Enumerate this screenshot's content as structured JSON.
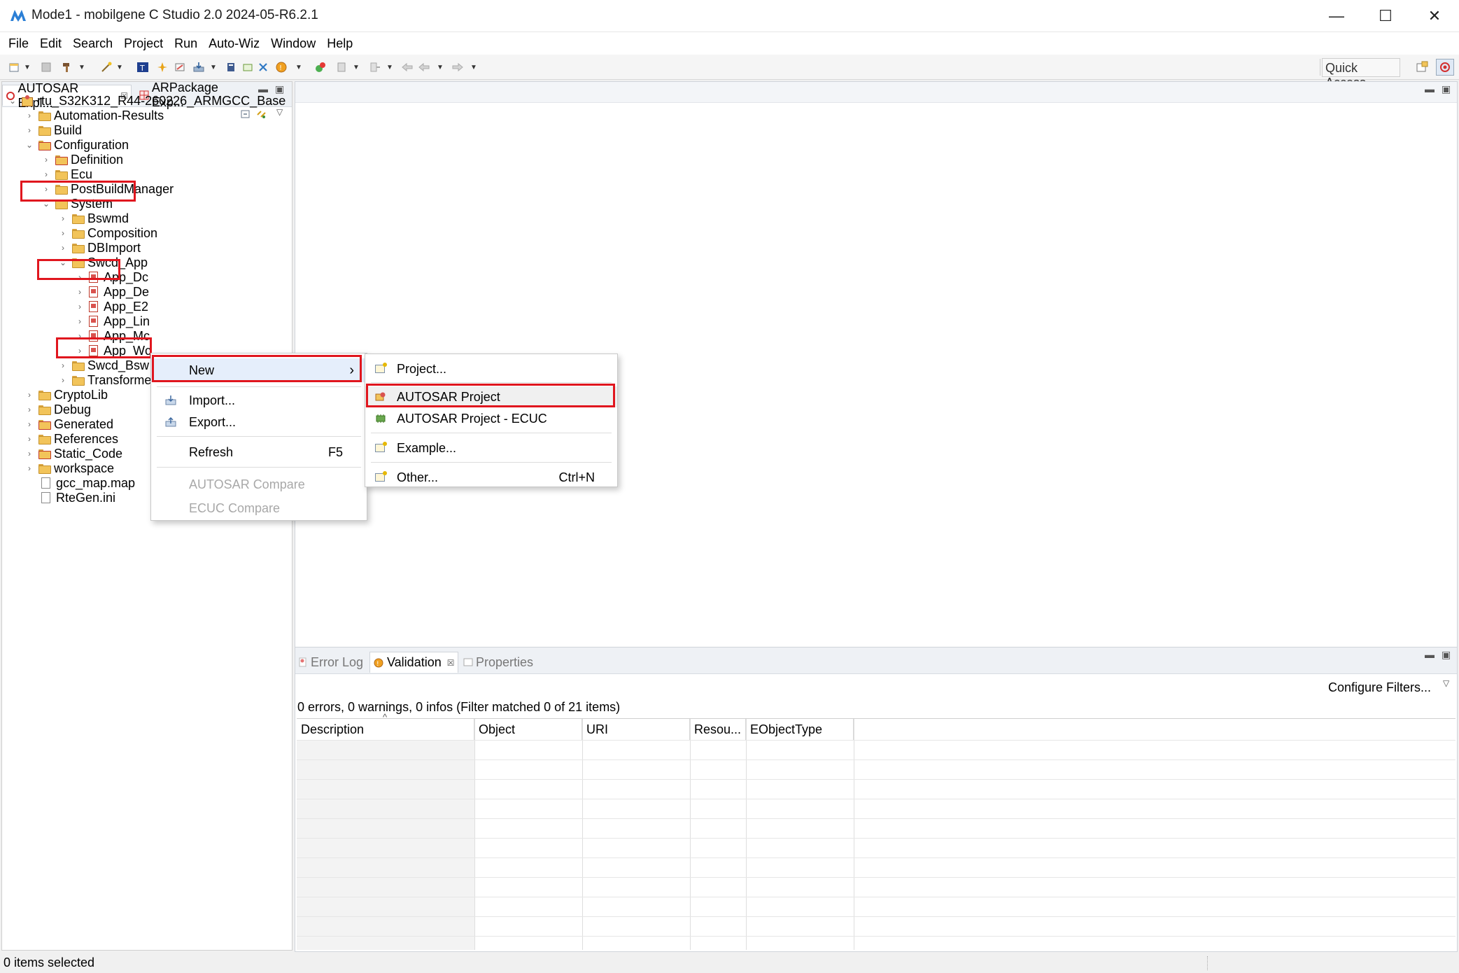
{
  "window": {
    "title": "Mode1 - mobilgene C Studio 2.0 2024-05-R6.2.1",
    "controls": {
      "minimize": "—",
      "maximize": "☐",
      "close": "✕"
    }
  },
  "menubar": [
    "File",
    "Edit",
    "Search",
    "Project",
    "Run",
    "Auto-Wiz",
    "Window",
    "Help"
  ],
  "toolbar": {
    "quick_access": "Quick Access"
  },
  "left_panel": {
    "tabs": [
      {
        "label": "AUTOSAR Expl...",
        "close": "☒"
      },
      {
        "label": "ARPackage Exp..."
      }
    ],
    "tree": [
      {
        "label": "rtu_S32K312_R44-260226_ARMGCC_Base",
        "chev": "⌄",
        "icon": "project"
      },
      {
        "label": "Automation-Results",
        "chev": "›"
      },
      {
        "label": "Build",
        "chev": "›"
      },
      {
        "label": "Configuration",
        "chev": "⌄"
      },
      {
        "label": "Definition",
        "chev": "›"
      },
      {
        "label": "Ecu",
        "chev": "›"
      },
      {
        "label": "PostBuildManager",
        "chev": "›"
      },
      {
        "label": "System",
        "chev": "⌄"
      },
      {
        "label": "Bswmd",
        "chev": "›"
      },
      {
        "label": "Composition",
        "chev": "›"
      },
      {
        "label": "DBImport",
        "chev": "›"
      },
      {
        "label": "Swcd_App",
        "chev": "⌄"
      },
      {
        "label": "App_Dc",
        "chev": "›"
      },
      {
        "label": "App_De",
        "chev": "›"
      },
      {
        "label": "App_E2",
        "chev": "›"
      },
      {
        "label": "App_Lin",
        "chev": "›"
      },
      {
        "label": "App_Mc",
        "chev": "›"
      },
      {
        "label": "App_Wc",
        "chev": "›"
      },
      {
        "label": "Swcd_Bsw",
        "chev": "›"
      },
      {
        "label": "Transforme",
        "chev": "›"
      },
      {
        "label": "CryptoLib",
        "chev": "›"
      },
      {
        "label": "Debug",
        "chev": "›"
      },
      {
        "label": "Generated",
        "chev": "›"
      },
      {
        "label": "References",
        "chev": "›"
      },
      {
        "label": "Static_Code",
        "chev": "›"
      },
      {
        "label": "workspace",
        "chev": "›"
      },
      {
        "label": "gcc_map.map"
      },
      {
        "label": "RteGen.ini"
      }
    ]
  },
  "context_menu": {
    "items": [
      {
        "label": "New",
        "submenu_arrow": "›"
      },
      {
        "label": "Import..."
      },
      {
        "label": "Export..."
      },
      {
        "label": "Refresh",
        "accel": "F5"
      },
      {
        "label": "AUTOSAR Compare"
      },
      {
        "label": "ECUC Compare"
      }
    ]
  },
  "new_submenu": {
    "items": [
      {
        "label": "Project..."
      },
      {
        "label": "AUTOSAR Project"
      },
      {
        "label": "AUTOSAR Project - ECUC"
      },
      {
        "label": "Example..."
      },
      {
        "label": "Other...",
        "accel": "Ctrl+N"
      }
    ]
  },
  "bottom_panel": {
    "tabs": [
      "Error Log",
      "Validation",
      "Properties"
    ],
    "validation_close": "☒",
    "configure_filters": "Configure Filters...",
    "summary": "0 errors, 0 warnings, 0 infos (Filter matched 0 of 21 items)",
    "sort_indicator": "^",
    "columns": [
      "Description",
      "Object",
      "URI",
      "Resou...",
      "EObjectType"
    ]
  },
  "statusbar": {
    "text": "0 items selected"
  },
  "colors": {
    "highlight": "#e0161e",
    "folder": "#f2c45a",
    "panel_border": "#d0d4da"
  }
}
